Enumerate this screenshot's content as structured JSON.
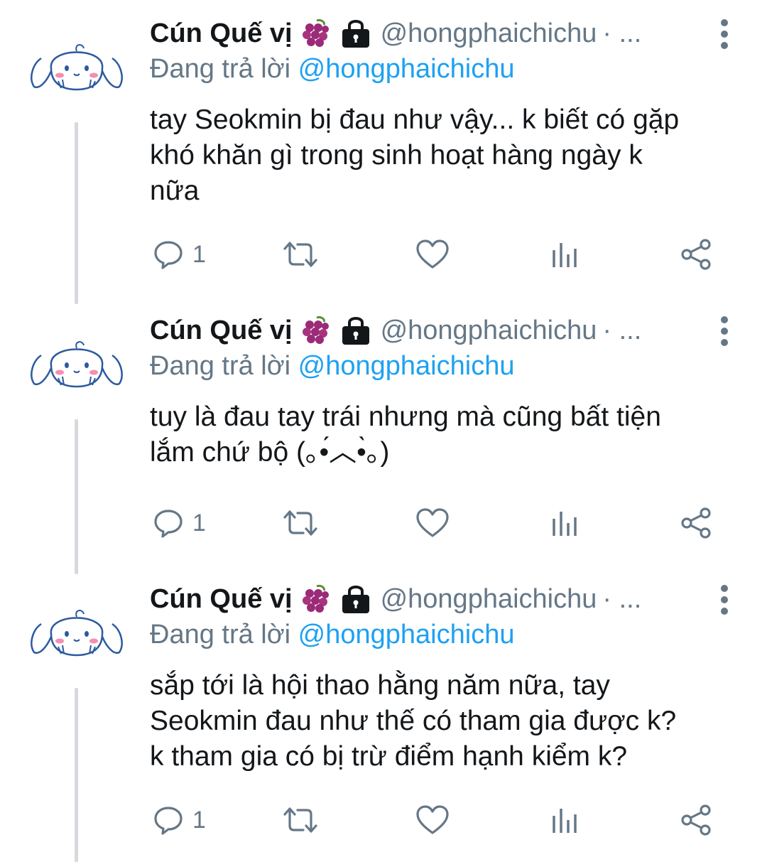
{
  "tweets": [
    {
      "name": "Cún Quế vị",
      "handle": "@hongphaichichu",
      "more_dots": "· ...",
      "replying_prefix": "Đang trả lời",
      "replying_to": "@hongphaichichu",
      "lines": [
        "tay Seokmin bị đau như vậy... k biết có gặp",
        "khó khăn gì trong sinh hoạt hàng ngày k",
        "nữa"
      ],
      "reply_count": "1"
    },
    {
      "name": "Cún Quế vị",
      "handle": "@hongphaichichu",
      "more_dots": "· ...",
      "replying_prefix": "Đang trả lời",
      "replying_to": "@hongphaichichu",
      "lines": [
        "tuy là đau tay trái nhưng mà cũng bất tiện",
        "lắm chứ bộ (｡•́︿•̀｡)"
      ],
      "reply_count": "1"
    },
    {
      "name": "Cún Quế vị",
      "handle": "@hongphaichichu",
      "more_dots": "· ...",
      "replying_prefix": "Đang trả lời",
      "replying_to": "@hongphaichichu",
      "lines": [
        "sắp tới là hội thao hằng năm nữa, tay",
        "Seokmin đau như thế có tham gia được k?",
        "k tham gia có bị trừ điểm hạnh kiểm k?"
      ],
      "reply_count": "1"
    }
  ],
  "icons": {
    "avatar": "cinnamoroll-avatar",
    "emoji_1": "grapes-emoji",
    "emoji_2": "lock-emoji",
    "more": "vertical-dots-icon",
    "reply": "reply-bubble-icon",
    "retweet": "retweet-icon",
    "like": "heart-icon",
    "analytics": "analytics-icon",
    "share": "share-icon"
  },
  "colors": {
    "text": "#14171a",
    "secondary": "#657786",
    "link": "#1da1f2",
    "thread_line": "#d6dadd",
    "grape": "#9b2a78",
    "avatar_line": "#2c5aa0",
    "avatar_blush": "#f48fb1"
  }
}
